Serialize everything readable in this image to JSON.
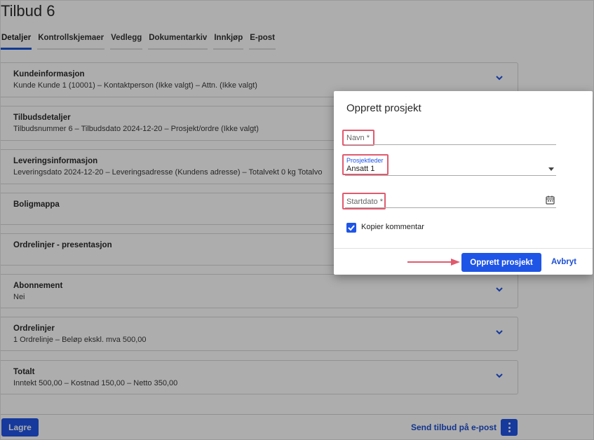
{
  "page": {
    "title": "Tilbud 6"
  },
  "tabs": [
    {
      "label": "Detaljer",
      "active": true
    },
    {
      "label": "Kontrollskjemaer",
      "active": false
    },
    {
      "label": "Vedlegg",
      "active": false
    },
    {
      "label": "Dokumentarkiv",
      "active": false
    },
    {
      "label": "Innkjøp",
      "active": false
    },
    {
      "label": "E-post",
      "active": false
    }
  ],
  "sections": [
    {
      "title": "Kundeinformasjon",
      "subtitle": "Kunde Kunde 1 (10001) – Kontaktperson (Ikke valgt) – Attn. (Ikke valgt)"
    },
    {
      "title": "Tilbudsdetaljer",
      "subtitle": "Tilbudsnummer 6 – Tilbudsdato 2024-12-20 – Prosjekt/ordre (Ikke valgt)"
    },
    {
      "title": "Leveringsinformasjon",
      "subtitle": "Leveringsdato 2024-12-20 – Leveringsadresse (Kundens adresse) – Totalvekt 0 kg Totalvo"
    },
    {
      "title": "Boligmappa",
      "subtitle": ""
    },
    {
      "title": "Ordrelinjer - presentasjon",
      "subtitle": ""
    },
    {
      "title": "Abonnement",
      "subtitle": "Nei"
    },
    {
      "title": "Ordrelinjer",
      "subtitle": "1 Ordrelinje – Beløp ekskl. mva 500,00"
    },
    {
      "title": "Totalt",
      "subtitle": "Inntekt 500,00 – Kostnad 150,00 – Netto 350,00"
    }
  ],
  "footer": {
    "save_label": "Lagre",
    "send_label": "Send tilbud på e-post"
  },
  "dialog": {
    "title": "Opprett prosjekt",
    "name_label": "Navn *",
    "manager_label": "Prosjektleder",
    "manager_value": "Ansatt 1",
    "startdate_label": "Startdato *",
    "copy_comment_label": "Kopier kommentar",
    "copy_comment_checked": true,
    "create_label": "Opprett prosjekt",
    "cancel_label": "Avbryt"
  },
  "colors": {
    "primary": "#1f55e6",
    "highlight": "#e05a6e"
  }
}
